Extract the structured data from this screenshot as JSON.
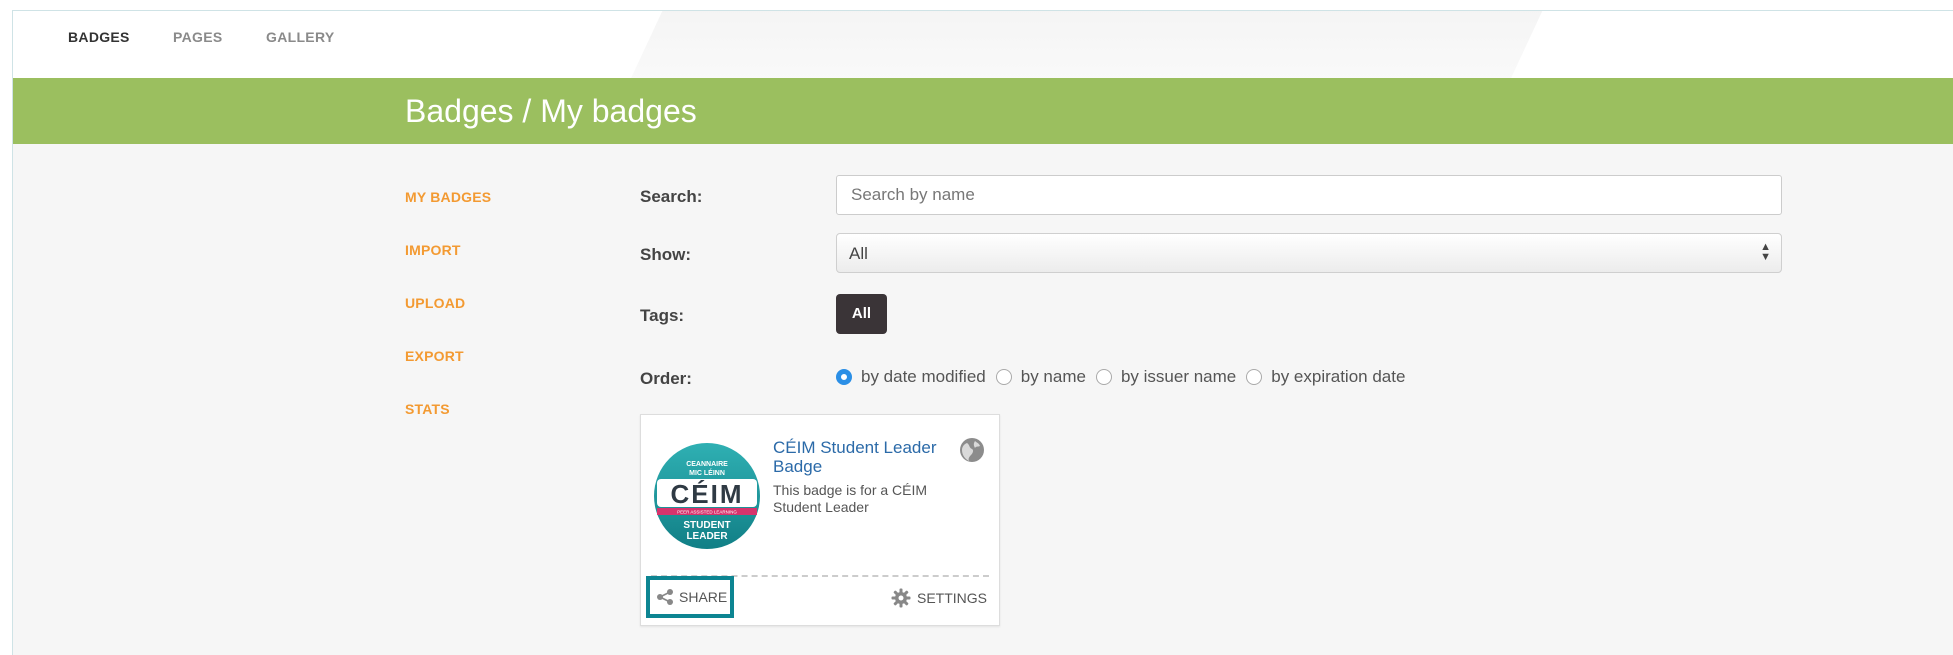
{
  "topnav": {
    "items": [
      {
        "label": "BADGES",
        "active": true
      },
      {
        "label": "PAGES",
        "active": false
      },
      {
        "label": "GALLERY",
        "active": false
      }
    ]
  },
  "header": {
    "title": "Badges / My badges"
  },
  "sidemenu": {
    "items": [
      "MY BADGES",
      "IMPORT",
      "UPLOAD",
      "EXPORT",
      "STATS"
    ]
  },
  "filters": {
    "search_label": "Search:",
    "search_placeholder": "Search by name",
    "show_label": "Show:",
    "show_value": "All",
    "tags_label": "Tags:",
    "tag_all": "All",
    "order_label": "Order:",
    "order_options": [
      "by date modified",
      "by name",
      "by issuer name",
      "by expiration date"
    ],
    "order_selected": "by date modified"
  },
  "badge_card": {
    "name": "CÉIM Student Leader Badge",
    "description": "This badge is for a CÉIM Student Leader",
    "logo_text": {
      "top": "CEANNAIRE",
      "top2": "MIC LÉINN",
      "main": "CÉIM",
      "strip": "PEER ASSISTED LEARNING",
      "bottom": "STUDENT",
      "bottom2": "LEADER"
    },
    "share_label": "SHARE",
    "settings_label": "SETTINGS"
  },
  "colors": {
    "header_green": "#9bbf5f",
    "menu_orange": "#f39a32",
    "link_blue": "#2b6aa8",
    "highlight_teal": "#0d8592",
    "radio_blue": "#2b8fe6"
  }
}
